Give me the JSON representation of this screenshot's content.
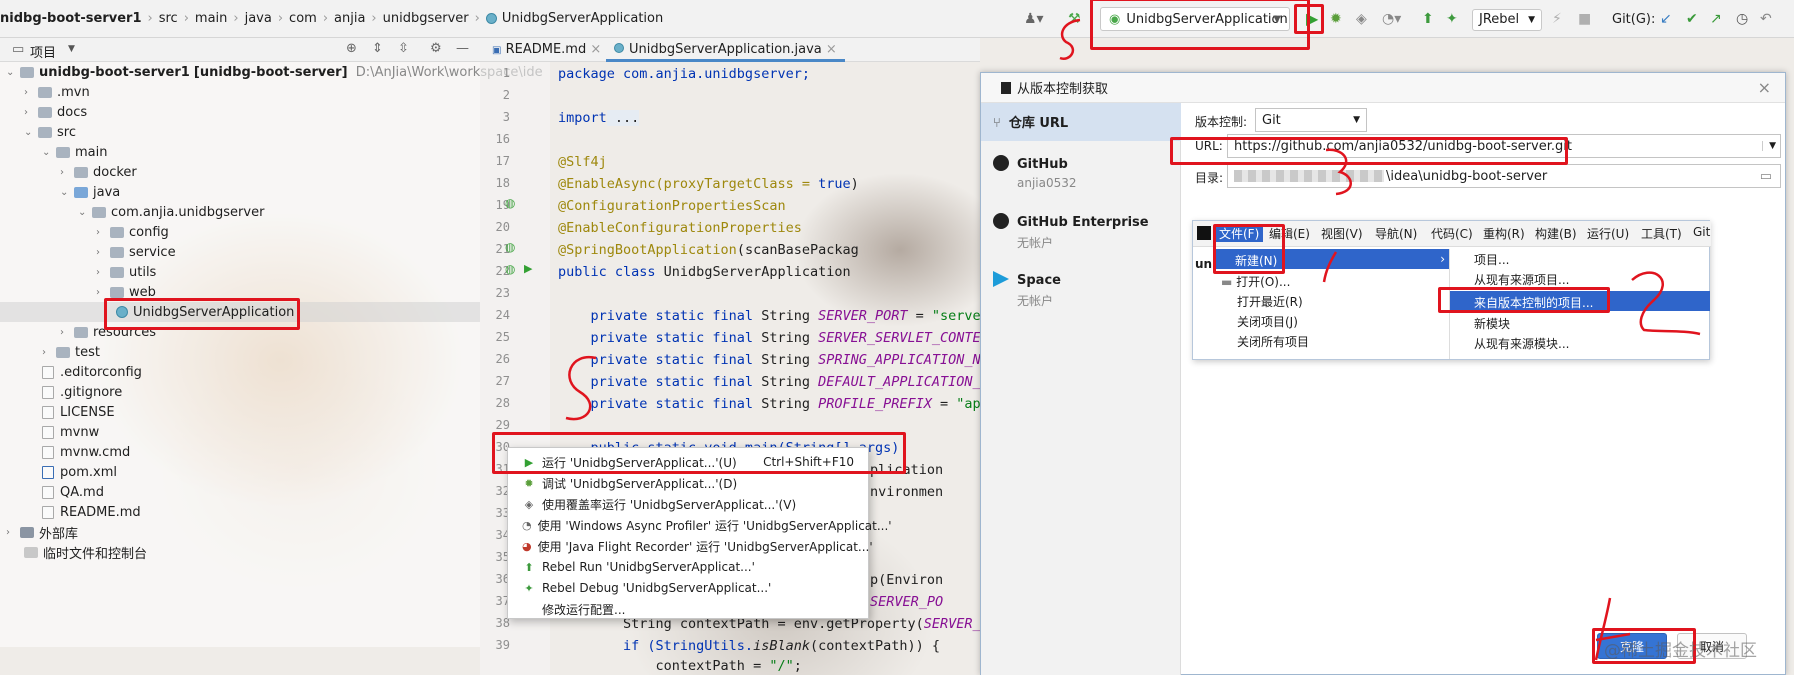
{
  "nav": {
    "breadcrumb": [
      "nidbg-boot-server1",
      "src",
      "main",
      "java",
      "com",
      "anjia",
      "unidbgserver",
      "UnidbgServerApplication"
    ],
    "run_config": "UnidbgServerApplication",
    "jrebel": "JRebel",
    "git_label": "Git(G):"
  },
  "project_panel": {
    "title": "项目",
    "root": "unidbg-boot-server1",
    "root_module": "[unidbg-boot-server]",
    "root_path": "D:\\AnJia\\Work\\workspace\\ide",
    "items": [
      {
        "label": ".mvn",
        "type": "folder"
      },
      {
        "label": "docs",
        "type": "folder"
      },
      {
        "label": "src",
        "type": "folder"
      },
      {
        "label": "main",
        "type": "folder"
      },
      {
        "label": "docker",
        "type": "folder"
      },
      {
        "label": "java",
        "type": "folder"
      },
      {
        "label": "com.anjia.unidbgserver",
        "type": "package"
      },
      {
        "label": "config",
        "type": "package"
      },
      {
        "label": "service",
        "type": "package"
      },
      {
        "label": "utils",
        "type": "package"
      },
      {
        "label": "web",
        "type": "package"
      },
      {
        "label": "UnidbgServerApplication",
        "type": "class"
      },
      {
        "label": "resources",
        "type": "folder"
      },
      {
        "label": "test",
        "type": "folder"
      },
      {
        "label": ".editorconfig",
        "type": "file"
      },
      {
        "label": ".gitignore",
        "type": "file"
      },
      {
        "label": "LICENSE",
        "type": "file"
      },
      {
        "label": "mvnw",
        "type": "file"
      },
      {
        "label": "mvnw.cmd",
        "type": "file"
      },
      {
        "label": "pom.xml",
        "type": "file"
      },
      {
        "label": "QA.md",
        "type": "file"
      },
      {
        "label": "README.md",
        "type": "file"
      },
      {
        "label": "外部库",
        "type": "folder"
      },
      {
        "label": "临时文件和控制台",
        "type": "folder"
      }
    ]
  },
  "editor": {
    "tabs": [
      "README.md",
      "UnidbgServerApplication.java"
    ],
    "line_numbers": [
      "1",
      "2",
      "3",
      "16",
      "17",
      "18",
      "19",
      "20",
      "21",
      "22",
      "23",
      "24",
      "25",
      "26",
      "27",
      "28",
      "29",
      "30",
      "31",
      "32",
      "33",
      "34",
      "35",
      "36",
      "37",
      "38",
      "39"
    ],
    "lines": {
      "l1": "package com.anjia.unidbgserver;",
      "l3_kw": "import",
      "l3_rest": " ...",
      "l16": "@Slf4j",
      "l17a": "@EnableAsync(proxyTargetClass = ",
      "l17b": "true",
      "l17c": ")",
      "l18": "@ConfigurationPropertiesScan",
      "l19": "@EnableConfigurationProperties",
      "l20a": "@SpringBootApplication",
      "l20b": "(scanBasePackag",
      "l21a": "public class",
      "l21b": " UnidbgServerApplication",
      "l23a": "    private static final ",
      "l23b": "String ",
      "l23c": "SERVER_PORT",
      "l23d": " = ",
      "l23e": "\"server",
      "l24c": "SERVER_SERVLET_CONTEX",
      "l25c": "SPRING_APPLICATION_NA",
      "l26c": "DEFAULT_APPLICATION_N",
      "l27c": "PROFILE_PREFIX",
      "l27e": "\"app",
      "l29": "    public static void main(String[] args)",
      "l30": "plication",
      "l31": "nvironmen",
      "l35a": "p(Environ",
      "l36": "SERVER_PO",
      "l37a": "        String contextPath = env.getProperty(",
      "l37b": "SERVER_S",
      "l38a": "        if (StringUtils.",
      "l38b": "isBlank",
      "l38c": "(contextPath)) {",
      "l39a": "            contextPath = ",
      "l39b": "\"/\"",
      "l39c": ";"
    }
  },
  "context_menu": {
    "items": [
      {
        "label": "运行 'UnidbgServerApplicat...'(U)",
        "shortcut": "Ctrl+Shift+F10",
        "icon": "run-icon"
      },
      {
        "label": "调试 'UnidbgServerApplicat...'(D)",
        "shortcut": "",
        "icon": "debug-icon"
      },
      {
        "label": "使用覆盖率运行 'UnidbgServerApplicat...'(V)",
        "shortcut": "",
        "icon": "coverage-icon"
      },
      {
        "label": "使用 'Windows Async Profiler' 运行 'UnidbgServerApplicat...'",
        "shortcut": "",
        "icon": "profiler-icon"
      },
      {
        "label": "使用 'Java Flight Recorder' 运行 'UnidbgServerApplicat...'",
        "shortcut": "",
        "icon": "recorder-icon"
      },
      {
        "label": "Rebel Run 'UnidbgServerApplicat...'",
        "shortcut": "",
        "icon": "rebel-run-icon"
      },
      {
        "label": "Rebel Debug 'UnidbgServerApplicat...'",
        "shortcut": "",
        "icon": "rebel-debug-icon"
      },
      {
        "label": "修改运行配置...",
        "shortcut": "",
        "icon": ""
      }
    ]
  },
  "dialog": {
    "title": "从版本控制获取",
    "sidebar": [
      {
        "label": "仓库 URL",
        "sub": ""
      },
      {
        "label": "GitHub",
        "sub": "anjia0532"
      },
      {
        "label": "GitHub Enterprise",
        "sub": "无帐户"
      },
      {
        "label": "Space",
        "sub": "无帐户"
      }
    ],
    "vcs_label": "版本控制:",
    "vcs_value": "Git",
    "url_label": "URL:",
    "url_value": "https://github.com/anjia0532/unidbg-boot-server.git",
    "dir_label": "目录:",
    "dir_value": "\\idea\\unidbg-boot-server",
    "clone_button": "克隆",
    "cancel_button": "取消"
  },
  "embedded_menu": {
    "menubar": [
      "文件(F)",
      "编辑(E)",
      "视图(V)",
      "导航(N)",
      "代码(C)",
      "重构(R)",
      "构建(B)",
      "运行(U)",
      "工具(T)",
      "Git"
    ],
    "file_menu": [
      "新建(N)",
      "打开(O)...",
      "打开最近(R)",
      "关闭项目(J)",
      "关闭所有项目"
    ],
    "new_submenu": [
      "项目...",
      "从现有来源项目...",
      "来自版本控制的项目...",
      "新模块",
      "从现有来源模块..."
    ],
    "side_label": "un"
  },
  "annotations": [
    "1",
    "2",
    "3",
    "4",
    "5"
  ],
  "watermark": "@稀土掘金技术社区"
}
